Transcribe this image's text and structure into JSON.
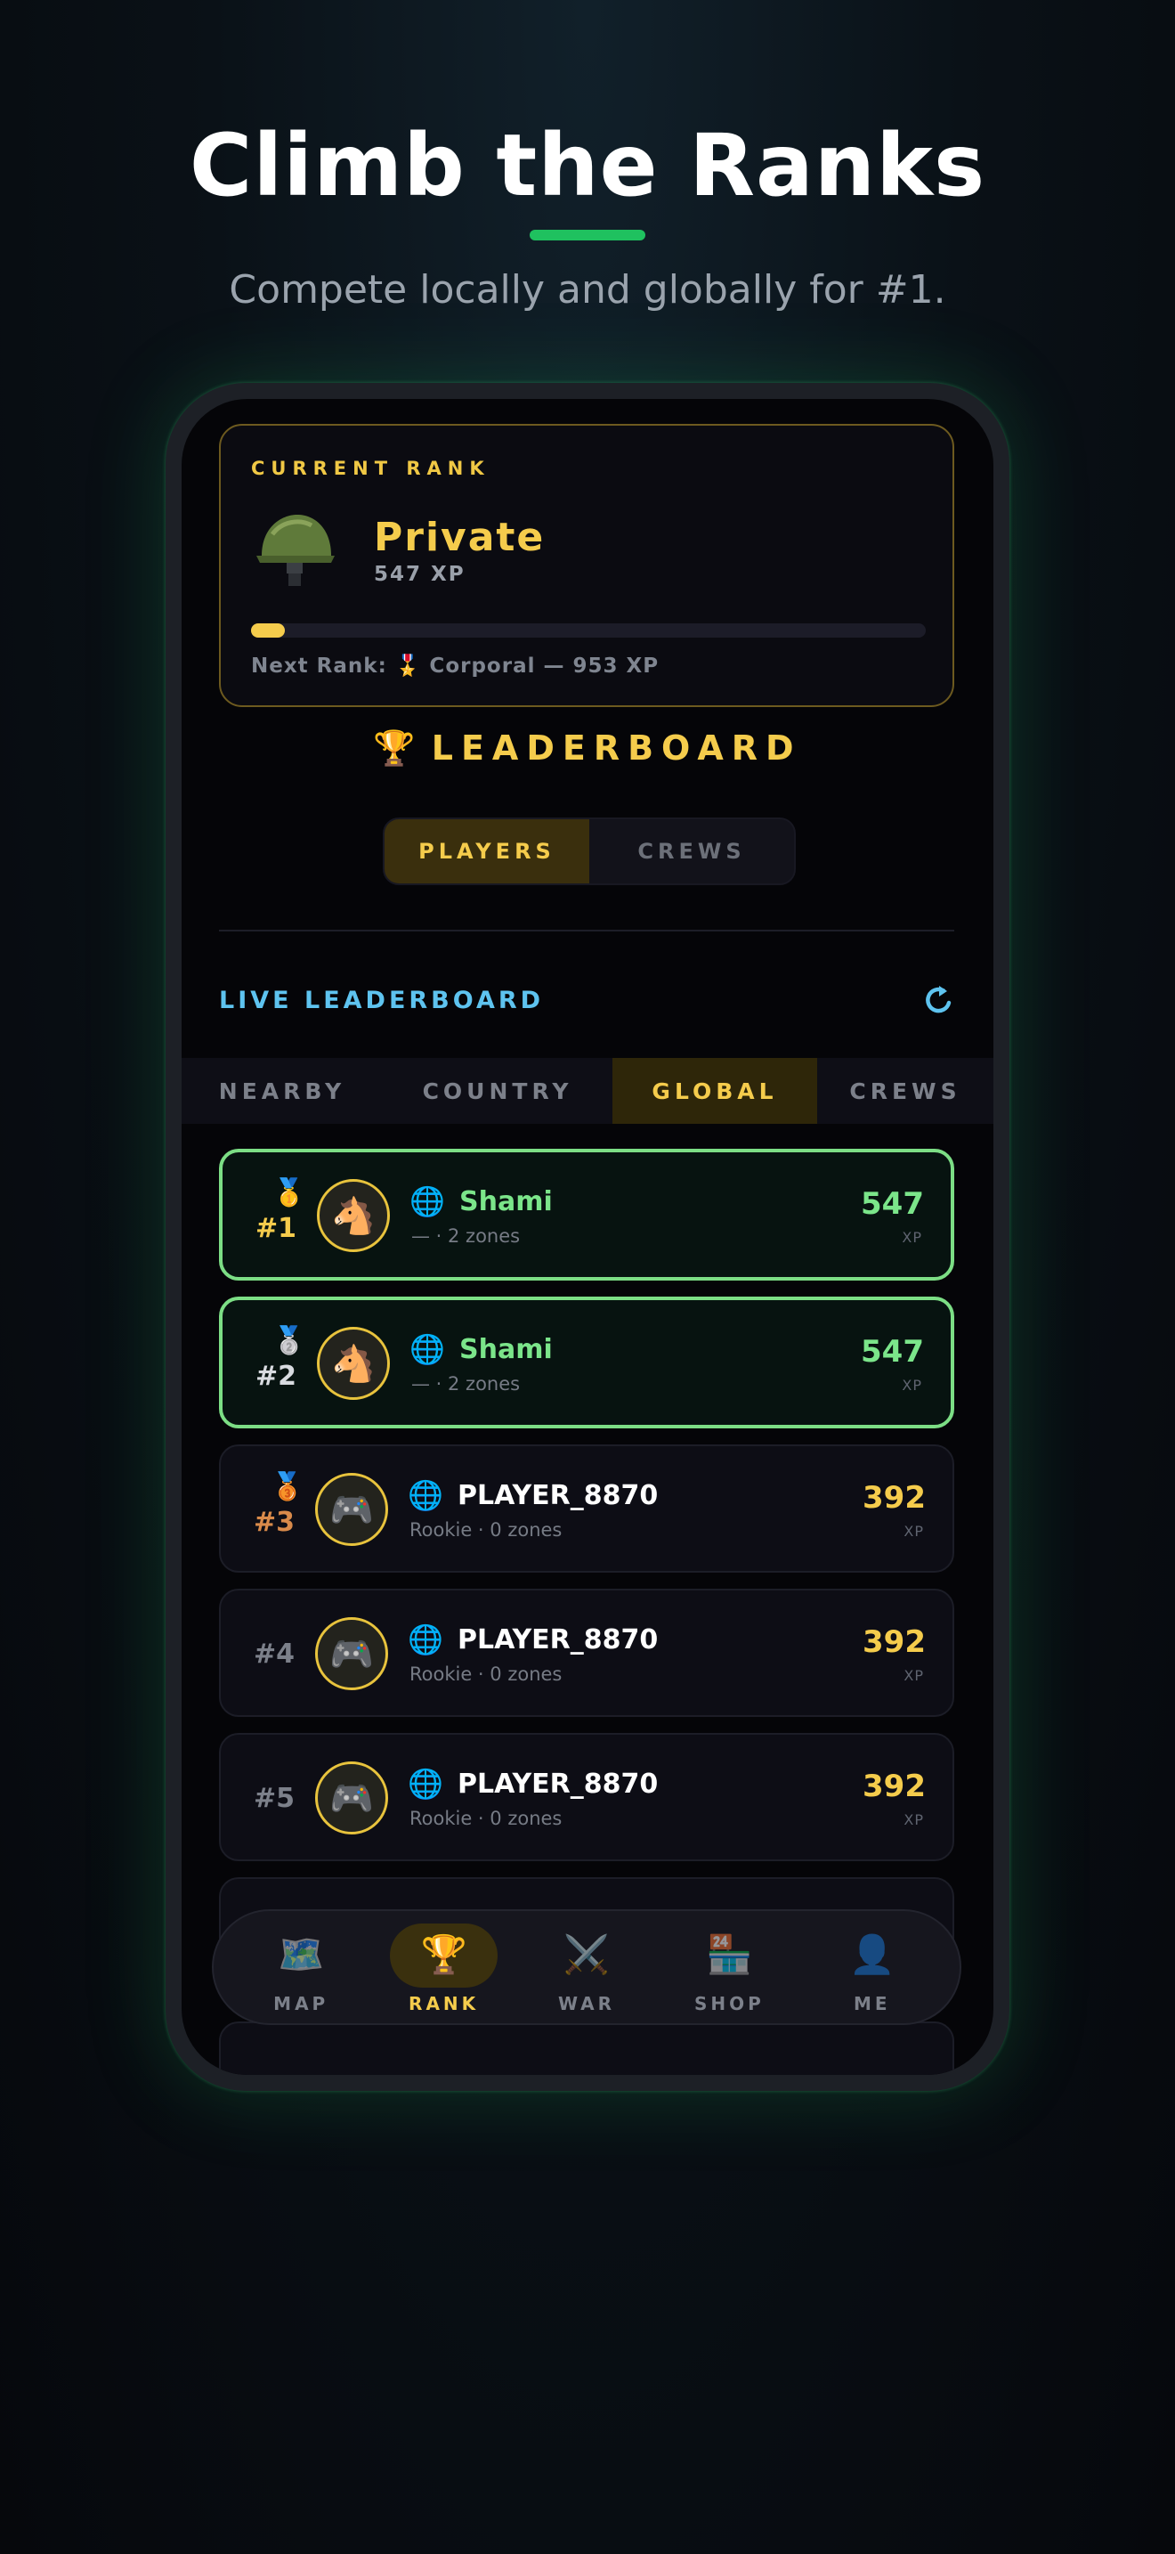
{
  "hero": {
    "title": "Climb the Ranks",
    "subtitle": "Compete locally and globally for #1."
  },
  "rank_card": {
    "caption": "CURRENT RANK",
    "icon": "military-helmet-icon",
    "rank": "Private",
    "xp": "547 XP",
    "progress_fraction": 0.05,
    "next_rank": "Next Rank: 🎖️ Corporal — 953 XP"
  },
  "leaderboard": {
    "icon": "🏆",
    "title": "LEADERBOARD",
    "segments": [
      "PLAYERS",
      "CREWS"
    ],
    "active_segment": "PLAYERS",
    "live_title": "LIVE LEADERBOARD",
    "tabs": [
      "NEARBY",
      "COUNTRY",
      "GLOBAL",
      "CREWS"
    ],
    "active_tab": "GLOBAL",
    "xp_unit": "XP",
    "rows": [
      {
        "medal": "🥇",
        "rank": "#1",
        "avatar": "🐴",
        "globe": "🌐",
        "name": "Shami",
        "sub": "— · 2 zones",
        "xp": "547"
      },
      {
        "medal": "🥈",
        "rank": "#2",
        "avatar": "🐴",
        "globe": "🌐",
        "name": "Shami",
        "sub": "— · 2 zones",
        "xp": "547"
      },
      {
        "medal": "🥉",
        "rank": "#3",
        "avatar": "🎮",
        "globe": "🌐",
        "name": "PLAYER_8870",
        "sub": "Rookie · 0 zones",
        "xp": "392"
      },
      {
        "medal": "",
        "rank": "#4",
        "avatar": "🎮",
        "globe": "🌐",
        "name": "PLAYER_8870",
        "sub": "Rookie · 0 zones",
        "xp": "392"
      },
      {
        "medal": "",
        "rank": "#5",
        "avatar": "🎮",
        "globe": "🌐",
        "name": "PLAYER_8870",
        "sub": "Rookie · 0 zones",
        "xp": "392"
      }
    ]
  },
  "nav": {
    "items": [
      {
        "icon": "🗺️",
        "label": "MAP"
      },
      {
        "icon": "🏆",
        "label": "RANK"
      },
      {
        "icon": "⚔️",
        "label": "WAR"
      },
      {
        "icon": "🏪",
        "label": "SHOP"
      },
      {
        "icon": "👤",
        "label": "ME"
      }
    ],
    "active": "RANK"
  },
  "colors": {
    "accent_gold": "#f5cc4c",
    "accent_green": "#1fc15f",
    "highlight_green": "#7be58a",
    "live_blue": "#5ec3ef"
  }
}
